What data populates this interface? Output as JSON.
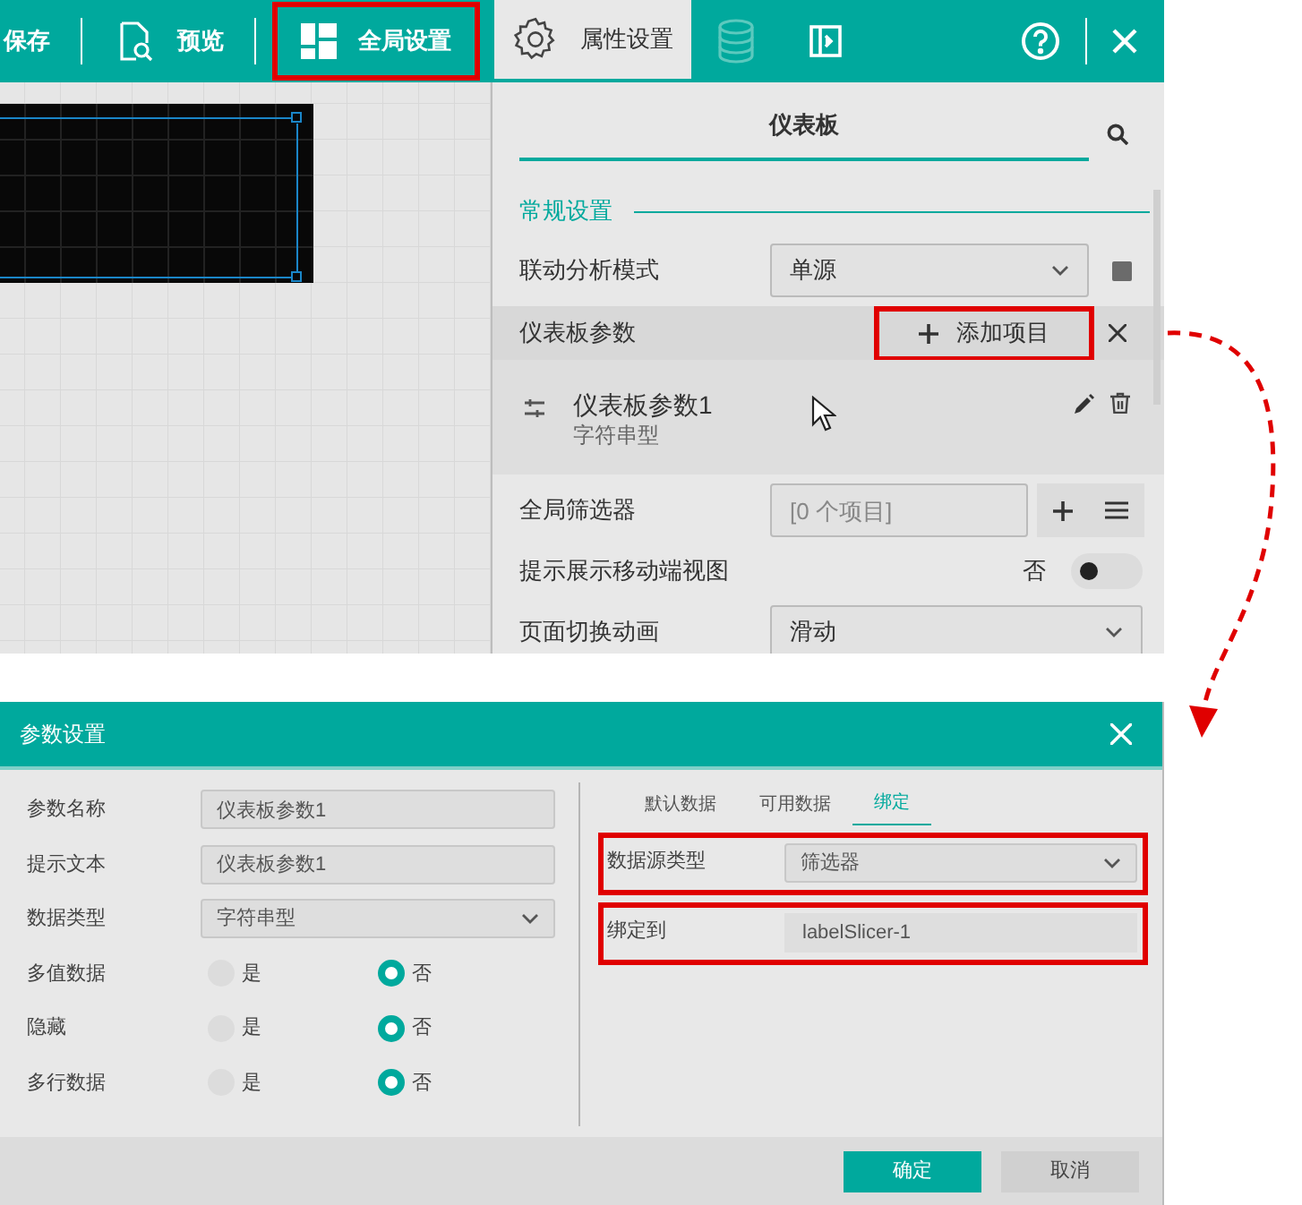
{
  "toolbar": {
    "items": [
      {
        "kind": "text",
        "label": "保存",
        "highlighted": false
      },
      {
        "kind": "preview",
        "label": "预览",
        "highlighted": false
      },
      {
        "kind": "layout",
        "label": "全局设置",
        "highlighted": true
      }
    ]
  },
  "panel_tabs": [
    {
      "kind": "gear",
      "label": "属性设置",
      "selected": true
    },
    {
      "kind": "database",
      "selected": false
    },
    {
      "kind": "panel",
      "selected": false
    }
  ],
  "panel": {
    "title": "仪表板",
    "section": "常规设置",
    "linkage": {
      "label": "联动分析模式",
      "value": "单源"
    },
    "params": {
      "label": "仪表板参数",
      "add_label": "添加项目",
      "add_highlighted": true,
      "items": [
        {
          "name": "仪表板参数1",
          "type": "字符串型"
        }
      ]
    },
    "global_filter": {
      "label": "全局筛选器",
      "placeholder": "[0 个项目]"
    },
    "mobile_view": {
      "label": "提示展示移动端视图",
      "value": "否",
      "on": false
    },
    "page_animation": {
      "label": "页面切换动画",
      "value": "滑动"
    }
  },
  "dialog": {
    "title": "参数设置",
    "fields": [
      {
        "kind": "input",
        "label": "参数名称",
        "value": "仪表板参数1"
      },
      {
        "kind": "input",
        "label": "提示文本",
        "value": "仪表板参数1"
      },
      {
        "kind": "select",
        "label": "数据类型",
        "value": "字符串型"
      },
      {
        "kind": "radio",
        "label": "多值数据",
        "options": [
          {
            "label": "是",
            "selected": false
          },
          {
            "label": "否",
            "selected": true
          }
        ]
      },
      {
        "kind": "radio",
        "label": "隐藏",
        "options": [
          {
            "label": "是",
            "selected": false
          },
          {
            "label": "否",
            "selected": true
          }
        ]
      },
      {
        "kind": "radio",
        "label": "多行数据",
        "options": [
          {
            "label": "是",
            "selected": false
          },
          {
            "label": "否",
            "selected": true
          }
        ]
      }
    ],
    "tabs": [
      {
        "label": "默认数据",
        "selected": false
      },
      {
        "label": "可用数据",
        "selected": false
      },
      {
        "label": "绑定",
        "selected": true
      }
    ],
    "binding": [
      {
        "kind": "select",
        "label": "数据源类型",
        "value": "筛选器",
        "highlighted": true
      },
      {
        "kind": "readonly",
        "label": "绑定到",
        "value": "labelSlicer-1",
        "highlighted": true
      }
    ],
    "buttons": [
      {
        "kind": "primary",
        "label": "确定"
      },
      {
        "kind": "secondary",
        "label": "取消"
      }
    ]
  }
}
